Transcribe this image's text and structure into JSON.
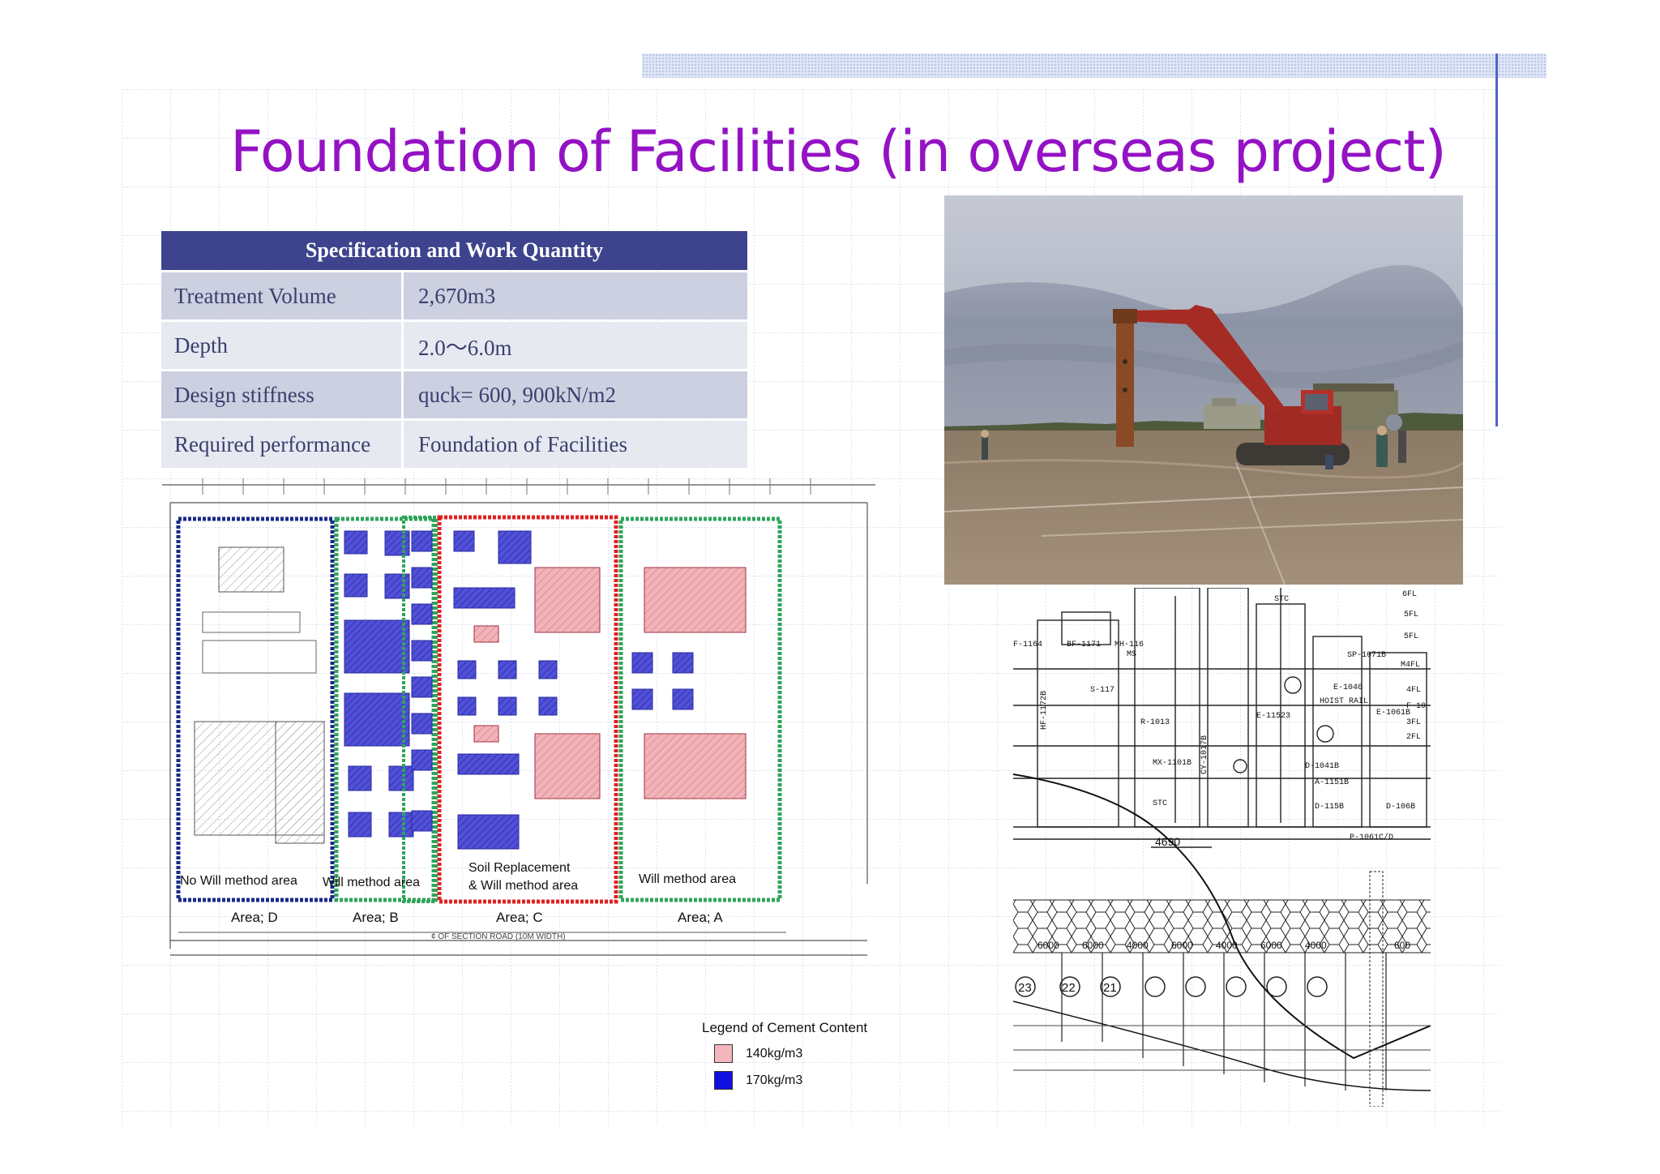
{
  "slide": {
    "title": "Foundation of Facilities (in overseas project)"
  },
  "spec_table": {
    "header": "Specification and Work Quantity",
    "rows": [
      {
        "label": "Treatment Volume",
        "value": "2,670m3"
      },
      {
        "label": "Depth",
        "value": "2.0～6.0m"
      },
      {
        "label": "Design stiffness",
        "value": "quck=  600, 900kN/m2"
      },
      {
        "label": "Required performance",
        "value": "Foundation of Facilities"
      }
    ]
  },
  "plan": {
    "zones": [
      {
        "label": "No Will method area",
        "area": "Area; D",
        "border_color": "#1a2a8a"
      },
      {
        "label": "Will method area",
        "area": "Area; B",
        "border_color": "#2fa45a"
      },
      {
        "label": "Soil Replacement",
        "label2": "& Will method area",
        "area": "Area; C",
        "border_color": "#e02020"
      },
      {
        "label": "Will method area",
        "area": "Area; A",
        "border_color": "#2fa45a"
      }
    ],
    "road_label": "¢ OF SECTION ROAD (10M WIDTH)"
  },
  "legend": {
    "title": "Legend of Cement Content",
    "items": [
      {
        "label": "140kg/m3",
        "color": "#f4b6bd"
      },
      {
        "label": "170kg/m3",
        "color": "#1010e0"
      }
    ]
  },
  "section": {
    "dimension": "4690",
    "bottom_dims": [
      "6000",
      "6000",
      "4000",
      "6000",
      "4000",
      "6000",
      "4000",
      "600"
    ],
    "axis_labels": [
      "23",
      "22",
      "21"
    ],
    "floor_labels": [
      "6FL",
      "5FL",
      "5FL",
      "M4FL",
      "4FL",
      "F-10",
      "3FL",
      "2FL"
    ],
    "equipment_labels": [
      "F-1164",
      "BF-1171",
      "MH-116",
      "MS",
      "STC",
      "S-117",
      "HF-1172B",
      "R-1013",
      "CY-1017B",
      "E-11523",
      "HOIST RAIL",
      "E-1061B",
      "D-1041B",
      "A-1151B",
      "D-115B",
      "D-106B",
      "P-1061C/D",
      "MX-1101B",
      "STC",
      "SP-1071B",
      "E-1040"
    ]
  },
  "icons": {
    "photo": "excavator-photo-icon"
  }
}
